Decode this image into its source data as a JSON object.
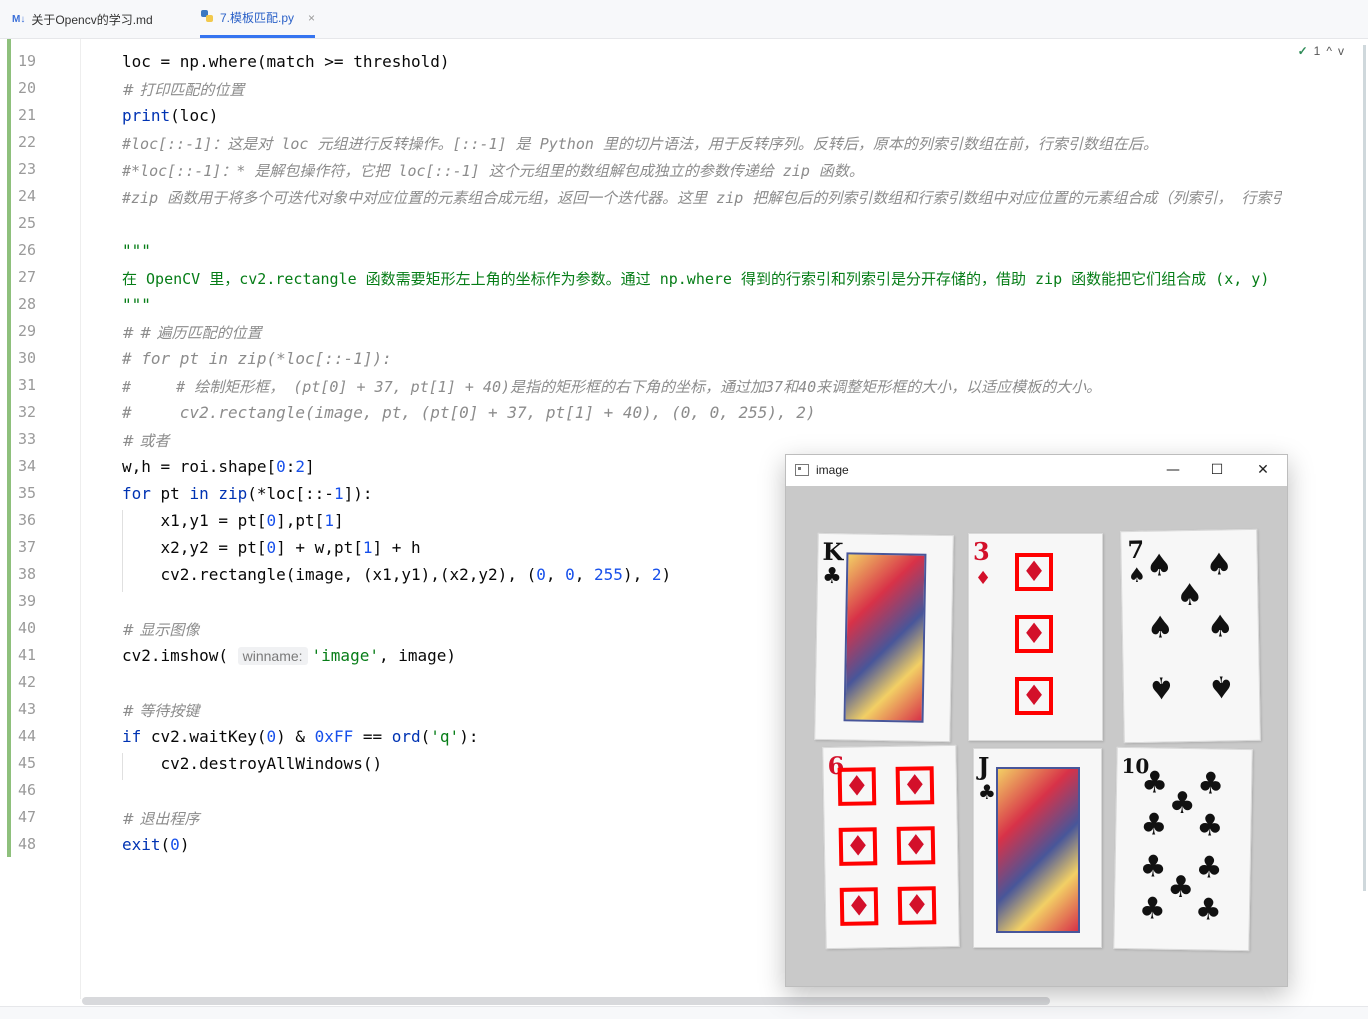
{
  "tabs": [
    {
      "label": "关于Opencv的学习.md",
      "icon": "M↓"
    },
    {
      "label": "7.模板匹配.py",
      "icon": "python-icon",
      "close": "×"
    }
  ],
  "inspection": {
    "count": "1",
    "up": "^",
    "down": "v"
  },
  "lines": [
    {
      "n": "19"
    },
    {
      "n": "20"
    },
    {
      "n": "21"
    },
    {
      "n": "22"
    },
    {
      "n": "23"
    },
    {
      "n": "24"
    },
    {
      "n": "25"
    },
    {
      "n": "26"
    },
    {
      "n": "27"
    },
    {
      "n": "28"
    },
    {
      "n": "29"
    },
    {
      "n": "30"
    },
    {
      "n": "31"
    },
    {
      "n": "32"
    },
    {
      "n": "33"
    },
    {
      "n": "34"
    },
    {
      "n": "35"
    },
    {
      "n": "36"
    },
    {
      "n": "37"
    },
    {
      "n": "38"
    },
    {
      "n": "39"
    },
    {
      "n": "40"
    },
    {
      "n": "41"
    },
    {
      "n": "42"
    },
    {
      "n": "43"
    },
    {
      "n": "44"
    },
    {
      "n": "45"
    },
    {
      "n": "46"
    },
    {
      "n": "47"
    },
    {
      "n": "48"
    }
  ],
  "code": {
    "l19": "loc = np.where(match >= threshold)",
    "l20": "# 打印匹配的位置",
    "l21a": "print",
    "l21b": "(loc)",
    "l22": "#loc[::-1]：这是对 loc 元组进行反转操作。[::-1] 是 Python 里的切片语法，用于反转序列。反转后，原本的列索引数组在前，行索引数组在后。",
    "l23": "#*loc[::-1]：* 是解包操作符，它把 loc[::-1] 这个元组里的数组解包成独立的参数传递给 zip 函数。",
    "l24": "#zip 函数用于将多个可迭代对象中对应位置的元素组合成元组，返回一个迭代器。这里 zip 把解包后的列索引数组和行索引数组中对应位置的元素组合成（列索引， 行索引",
    "l26": "\"\"\"",
    "l27": "在 OpenCV 里，cv2.rectangle 函数需要矩形左上角的坐标作为参数。通过 np.where 得到的行索引和列索引是分开存储的，借助 zip 函数能把它们组合成 (x, y)",
    "l28": "\"\"\"",
    "l29": "# # 遍历匹配的位置",
    "l30": "# for pt in zip(*loc[::-1]):",
    "l31": "#     # 绘制矩形框， (pt[0] + 37, pt[1] + 40)是指的矩形框的右下角的坐标，通过加37和40来调整矩形框的大小，以适应模板的大小。",
    "l32": "#     cv2.rectangle(image, pt, (pt[0] + 37, pt[1] + 40), (0, 0, 255), 2)",
    "l33": "# 或者",
    "l34a": "w,h = roi.shape[",
    "l34b": "0",
    "l34c": ":",
    "l34d": "2",
    "l34e": "]",
    "l35a": "for",
    "l35b": " pt ",
    "l35c": "in",
    "l35d": " zip",
    "l35e": "(*loc[::-",
    "l35f": "1",
    "l35g": "]):",
    "l36a": "    x1,y1 = pt[",
    "l36b": "0",
    "l36c": "],pt[",
    "l36d": "1",
    "l36e": "]",
    "l37a": "    x2,y2 = pt[",
    "l37b": "0",
    "l37c": "] + w,pt[",
    "l37d": "1",
    "l37e": "] + h",
    "l38a": "    cv2.rectangle(image, (x1,y1),(x2,y2), (",
    "l38b": "0",
    "l38c": ", ",
    "l38d": "0",
    "l38e": ", ",
    "l38f": "255",
    "l38g": "), ",
    "l38h": "2",
    "l38i": ")",
    "l40": "# 显示图像",
    "l41a": "cv2.imshow(",
    "l41hint": "winname:",
    "l41b": "'image'",
    "l41c": ", image)",
    "l43": "# 等待按键",
    "l44a": "if",
    "l44b": " cv2.waitKey(",
    "l44c": "0",
    "l44d": ") & ",
    "l44e": "0xFF",
    "l44f": " == ",
    "l44g": "ord",
    "l44h": "(",
    "l44i": "'q'",
    "l44j": "):",
    "l45": "    cv2.destroyAllWindows()",
    "l47": "# 退出程序",
    "l48a": "exit",
    "l48b": "(",
    "l48c": "0",
    "l48d": ")"
  },
  "image_window": {
    "title": "image",
    "minimize": "—",
    "maximize": "☐",
    "close": "✕",
    "cards": [
      {
        "rank": "K",
        "suit": "♣"
      },
      {
        "rank": "3",
        "suit": "♦"
      },
      {
        "rank": "7",
        "suit": "♠"
      },
      {
        "rank": "6",
        "suit": "♦"
      },
      {
        "rank": "J",
        "suit": "♣"
      },
      {
        "rank": "10",
        "suit": "♣"
      }
    ],
    "highlight_color": "#ff0000"
  }
}
